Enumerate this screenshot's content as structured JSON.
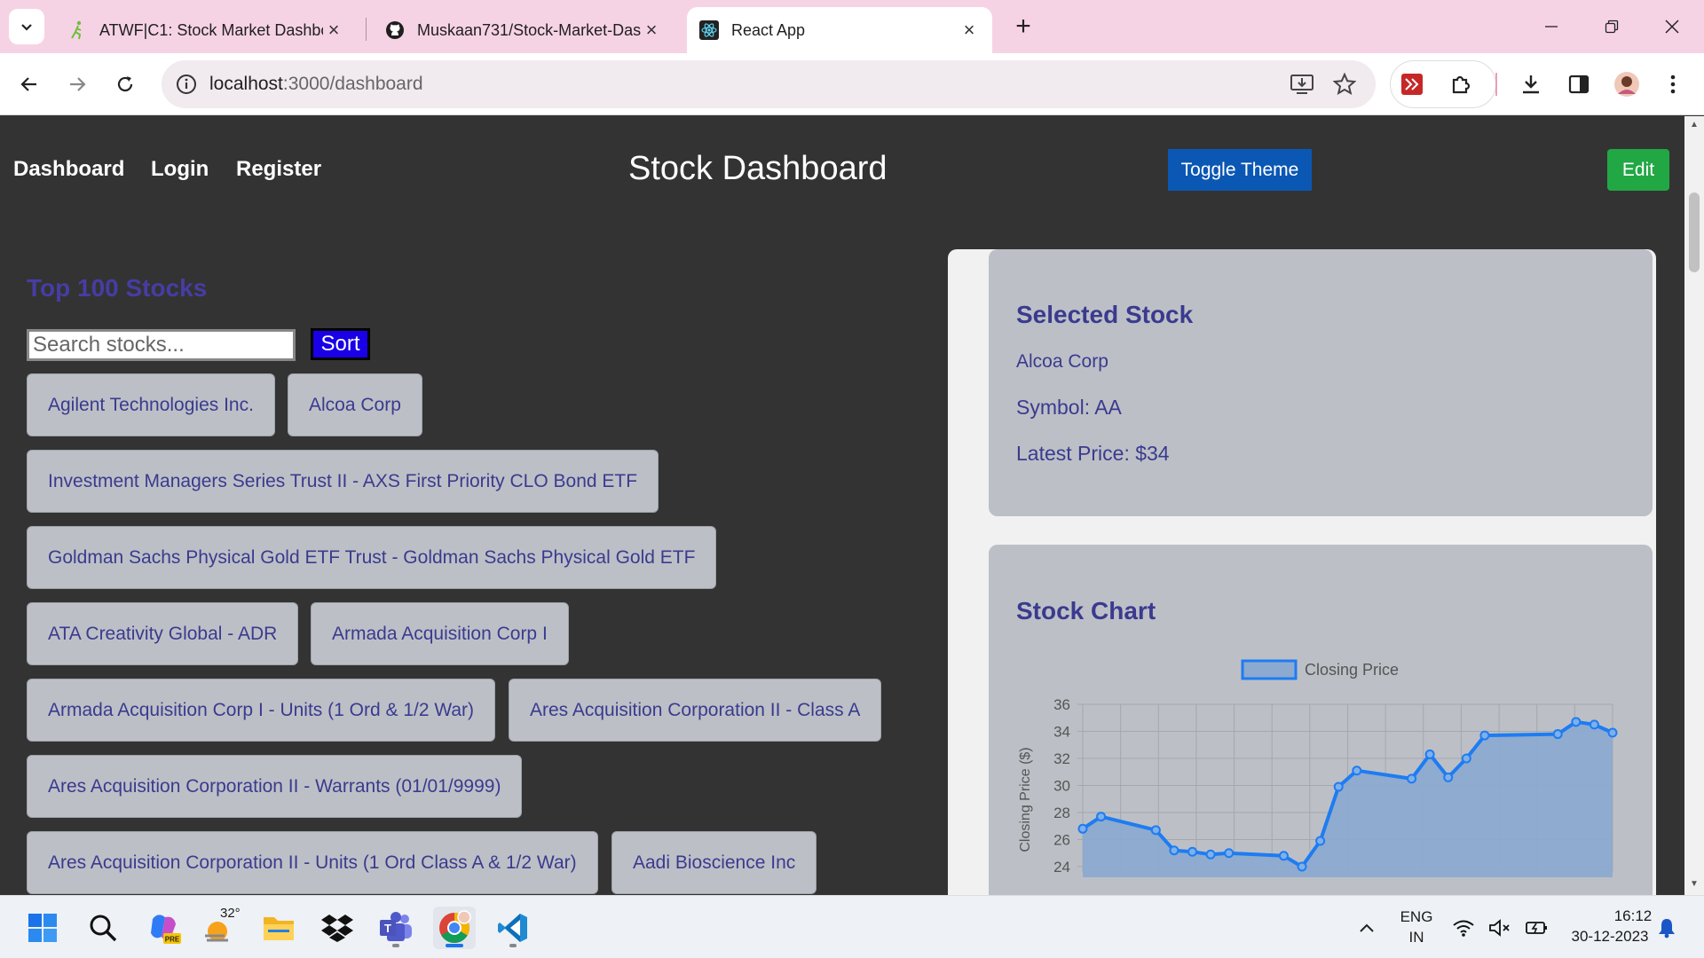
{
  "browser": {
    "tabs": [
      {
        "title": "ATWF|C1: Stock Market Dashbo",
        "icon": "runner-favicon-icon",
        "active": false
      },
      {
        "title": "Muskaan731/Stock-Market-Das",
        "icon": "github-icon",
        "active": false
      },
      {
        "title": "React App",
        "icon": "react-icon",
        "active": true
      }
    ],
    "url_host": "localhost",
    "url_path": ":3000/dashboard"
  },
  "nav": {
    "links": [
      "Dashboard",
      "Login",
      "Register"
    ],
    "title": "Stock Dashboard",
    "toggle_theme": "Toggle Theme",
    "edit": "Edit"
  },
  "stocks": {
    "heading": "Top 100 Stocks",
    "search_placeholder": "Search stocks...",
    "sort_label": "Sort",
    "items": [
      "Agilent Technologies Inc.",
      "Alcoa Corp",
      "Investment Managers Series Trust II - AXS First Priority CLO Bond ETF",
      "Goldman Sachs Physical Gold ETF Trust - Goldman Sachs Physical Gold ETF",
      "ATA Creativity Global - ADR",
      "Armada Acquisition Corp I",
      "Armada Acquisition Corp I - Units (1 Ord & 1/2 War)",
      "Ares Acquisition Corporation II - Class A",
      "Ares Acquisition Corporation II - Warrants (01/01/9999)",
      "Ares Acquisition Corporation II - Units (1 Ord Class A & 1/2 War)",
      "Aadi Bioscience Inc"
    ]
  },
  "selected": {
    "heading": "Selected Stock",
    "name": "Alcoa Corp",
    "symbol": "Symbol: AA",
    "price": "Latest Price: $34"
  },
  "chart_card": {
    "heading": "Stock Chart"
  },
  "chart_data": {
    "type": "line",
    "title": "",
    "xlabel": "",
    "ylabel": "Closing Price ($)",
    "legend": "Closing Price",
    "legend_position": "top",
    "ylim": [
      24,
      36
    ],
    "yticks": [
      24,
      26,
      28,
      30,
      32,
      34,
      36
    ],
    "grid": true,
    "series": [
      {
        "name": "Closing Price",
        "color": "#1e7cf2",
        "fill": "#8caad0",
        "values": [
          26.8,
          27.7,
          26.7,
          25.2,
          25.1,
          24.9,
          25.0,
          24.8,
          24.0,
          25.9,
          29.9,
          31.1,
          30.5,
          32.3,
          30.6,
          32.0,
          33.7,
          33.8,
          34.7,
          34.5,
          33.9
        ],
        "x_index": [
          0,
          1,
          4,
          5,
          6,
          7,
          8,
          11,
          12,
          13,
          14,
          15,
          18,
          19,
          20,
          21,
          22,
          26,
          27,
          28,
          29
        ]
      }
    ]
  },
  "taskbar": {
    "weather": "32°",
    "lang_top": "ENG",
    "lang_bottom": "IN",
    "time": "16:12",
    "date": "30-12-2023",
    "copilot_badge": "PRE"
  }
}
